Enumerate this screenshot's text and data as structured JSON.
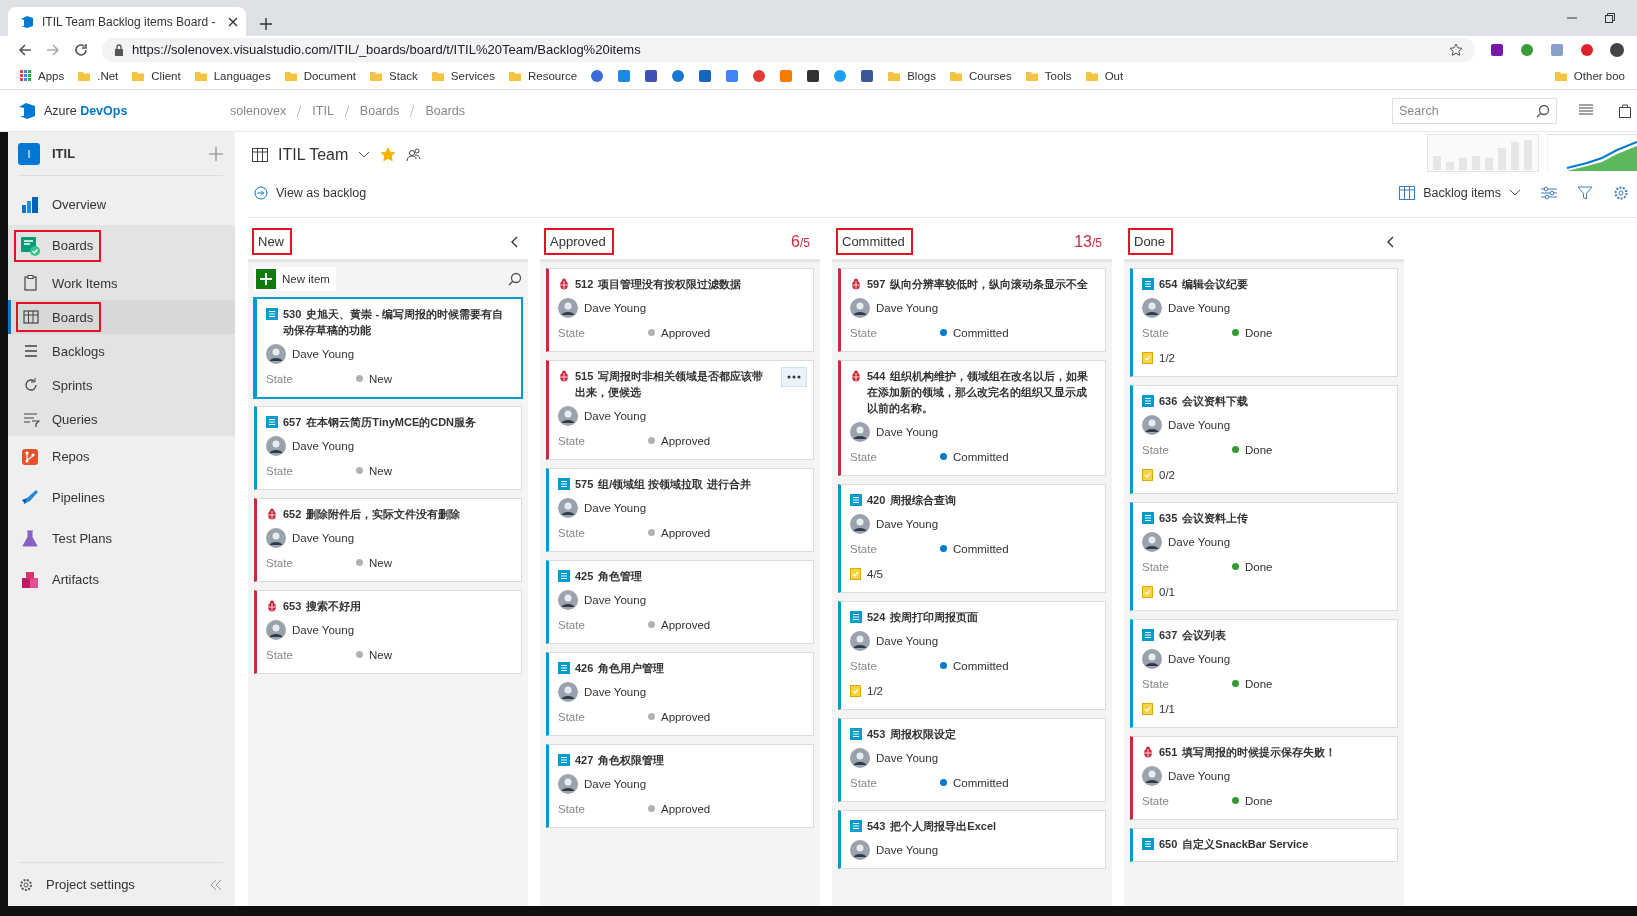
{
  "browser": {
    "tab_title": "ITIL Team Backlog items Board - ",
    "url": "https://solenovex.visualstudio.com/ITIL/_boards/board/t/ITIL%20Team/Backlog%20items",
    "bookmarks_left": [
      {
        "label": "Apps",
        "kind": "apps"
      },
      {
        "label": ".Net",
        "kind": "folder"
      },
      {
        "label": "Client",
        "kind": "folder"
      },
      {
        "label": "Languages",
        "kind": "folder"
      },
      {
        "label": "Document",
        "kind": "folder"
      },
      {
        "label": "Stack",
        "kind": "folder"
      },
      {
        "label": "Services",
        "kind": "folder"
      },
      {
        "label": "Resource",
        "kind": "folder"
      }
    ],
    "bookmarks_right": [
      {
        "label": "Blogs",
        "kind": "folder"
      },
      {
        "label": "Courses",
        "kind": "folder"
      },
      {
        "label": "Tools",
        "kind": "folder"
      },
      {
        "label": "Out",
        "kind": "folder"
      }
    ],
    "other_bookmarks": "Other boo"
  },
  "header": {
    "brand": "Azure **DevOps**",
    "breadcrumbs": [
      "solenovex",
      "ITIL",
      "Boards",
      "Boards"
    ],
    "search": {
      "placeholder": "Search"
    }
  },
  "sidebar": {
    "project": {
      "initial": "I",
      "name": "ITIL"
    },
    "items": [
      {
        "label": "Overview",
        "selected": false,
        "highlighted": false,
        "expanded": false
      },
      {
        "label": "Boards",
        "selected": false,
        "highlighted": true,
        "expanded": true,
        "children": [
          {
            "label": "Work Items",
            "selected": false,
            "highlighted": false
          },
          {
            "label": "Boards",
            "selected": true,
            "highlighted": true
          },
          {
            "label": "Backlogs",
            "selected": false,
            "highlighted": false
          },
          {
            "label": "Sprints",
            "selected": false,
            "highlighted": false
          },
          {
            "label": "Queries",
            "selected": false,
            "highlighted": false
          }
        ]
      },
      {
        "label": "Repos",
        "selected": false,
        "highlighted": false,
        "expanded": false
      },
      {
        "label": "Pipelines",
        "selected": false,
        "highlighted": false,
        "expanded": false
      },
      {
        "label": "Test Plans",
        "selected": false,
        "highlighted": false,
        "expanded": false
      },
      {
        "label": "Artifacts",
        "selected": false,
        "highlighted": false,
        "expanded": false
      }
    ],
    "settings": "Project settings"
  },
  "board": {
    "team": "ITIL Team",
    "favorite": true,
    "view_link": "View as backlog",
    "level_picker": "Backlog items",
    "columns": [
      {
        "name": "New",
        "highlighted": true,
        "collapsible": true,
        "new_item": "New item",
        "cards": [
          {
            "id": "530",
            "title": "史旭天、黄崇 - 编写周报的时候需要有自动保存草稿的功能",
            "kind": "story",
            "selected": true,
            "hovered": false,
            "assignee": "Dave Young",
            "state_label": "State",
            "state": "New",
            "color": "#b2b2b2"
          },
          {
            "id": "657",
            "title": "在本钢云简历TinyMCE的CDN服务",
            "kind": "story",
            "selected": false,
            "hovered": false,
            "assignee": "Dave Young",
            "state_label": "State",
            "state": "New",
            "color": "#b2b2b2"
          },
          {
            "id": "652",
            "title": "删除附件后，实际文件没有删除",
            "kind": "bug",
            "selected": false,
            "hovered": false,
            "assignee": "Dave Young",
            "state_label": "State",
            "state": "New",
            "color": "#b2b2b2"
          },
          {
            "id": "653",
            "title": "搜索不好用",
            "kind": "bug",
            "selected": false,
            "hovered": false,
            "assignee": "Dave Young",
            "state_label": "State",
            "state": "New",
            "color": "#b2b2b2"
          }
        ]
      },
      {
        "name": "Approved",
        "highlighted": true,
        "collapsible": false,
        "count": "6",
        "limit": "/5",
        "over_limit": true,
        "cards": [
          {
            "id": "512",
            "title": "项目管理没有按权限过滤数据",
            "kind": "bug",
            "selected": false,
            "hovered": false,
            "assignee": "Dave Young",
            "state_label": "State",
            "state": "Approved",
            "color": "#b2b2b2"
          },
          {
            "id": "515",
            "title": "写周报时非相关领域是否都应该带出来，便候选",
            "kind": "bug",
            "selected": false,
            "hovered": true,
            "assignee": "Dave Young",
            "state_label": "State",
            "state": "Approved",
            "color": "#b2b2b2"
          },
          {
            "id": "575",
            "title": "组/领域组 按领域拉取 进行合并",
            "kind": "story",
            "selected": false,
            "hovered": false,
            "assignee": "Dave Young",
            "state_label": "State",
            "state": "Approved",
            "color": "#b2b2b2"
          },
          {
            "id": "425",
            "title": "角色管理",
            "kind": "story",
            "selected": false,
            "hovered": false,
            "assignee": "Dave Young",
            "state_label": "State",
            "state": "Approved",
            "color": "#b2b2b2"
          },
          {
            "id": "426",
            "title": "角色用户管理",
            "kind": "story",
            "selected": false,
            "hovered": false,
            "assignee": "Dave Young",
            "state_label": "State",
            "state": "Approved",
            "color": "#b2b2b2"
          },
          {
            "id": "427",
            "title": "角色权限管理",
            "kind": "story",
            "selected": false,
            "hovered": false,
            "assignee": "Dave Young",
            "state_label": "State",
            "state": "Approved",
            "color": "#b2b2b2"
          }
        ]
      },
      {
        "name": "Committed",
        "highlighted": true,
        "collapsible": false,
        "count": "13",
        "limit": "/5",
        "over_limit": true,
        "cards": [
          {
            "id": "597",
            "title": "纵向分辨率较低时，纵向滚动条显示不全",
            "kind": "bug",
            "selected": false,
            "hovered": false,
            "assignee": "Dave Young",
            "state_label": "State",
            "state": "Committed",
            "color": "#007acc"
          },
          {
            "id": "544",
            "title": "组织机构维护，领域组在改名以后，如果在添加新的领域，那么改完名的组织又显示成以前的名称。",
            "kind": "bug",
            "selected": false,
            "hovered": false,
            "assignee": "Dave Young",
            "state_label": "State",
            "state": "Committed",
            "color": "#007acc"
          },
          {
            "id": "420",
            "title": "周报综合查询",
            "kind": "story",
            "selected": false,
            "hovered": false,
            "assignee": "Dave Young",
            "state_label": "State",
            "state": "Committed",
            "color": "#007acc",
            "tasks": "4/5"
          },
          {
            "id": "524",
            "title": "按周打印周报页面",
            "kind": "story",
            "selected": false,
            "hovered": false,
            "assignee": "Dave Young",
            "state_label": "State",
            "state": "Committed",
            "color": "#007acc",
            "tasks": "1/2"
          },
          {
            "id": "453",
            "title": "周报权限设定",
            "kind": "story",
            "selected": false,
            "hovered": false,
            "assignee": "Dave Young",
            "state_label": "State",
            "state": "Committed",
            "color": "#007acc"
          },
          {
            "id": "543",
            "title": "把个人周报导出Excel",
            "kind": "story",
            "selected": false,
            "hovered": false,
            "assignee": "Dave Young"
          }
        ]
      },
      {
        "name": "Done",
        "highlighted": true,
        "collapsible": true,
        "cards": [
          {
            "id": "654",
            "title": "编辑会议纪要",
            "kind": "story",
            "selected": false,
            "hovered": false,
            "assignee": "Dave Young",
            "state_label": "State",
            "state": "Done",
            "color": "#339933",
            "tasks": "1/2"
          },
          {
            "id": "636",
            "title": "会议资料下载",
            "kind": "story",
            "selected": false,
            "hovered": false,
            "assignee": "Dave Young",
            "state_label": "State",
            "state": "Done",
            "color": "#339933",
            "tasks": "0/2"
          },
          {
            "id": "635",
            "title": "会议资料上传",
            "kind": "story",
            "selected": false,
            "hovered": false,
            "assignee": "Dave Young",
            "state_label": "State",
            "state": "Done",
            "color": "#339933",
            "tasks": "0/1"
          },
          {
            "id": "637",
            "title": "会议列表",
            "kind": "story",
            "selected": false,
            "hovered": false,
            "assignee": "Dave Young",
            "state_label": "State",
            "state": "Done",
            "color": "#339933",
            "tasks": "1/1"
          },
          {
            "id": "651",
            "title": "填写周报的时候提示保存失败！",
            "kind": "bug",
            "selected": false,
            "hovered": false,
            "assignee": "Dave Young",
            "state_label": "State",
            "state": "Done",
            "color": "#339933"
          },
          {
            "id": "650",
            "title": "自定义SnackBar Service",
            "kind": "story",
            "selected": false,
            "hovered": false
          }
        ]
      }
    ]
  }
}
